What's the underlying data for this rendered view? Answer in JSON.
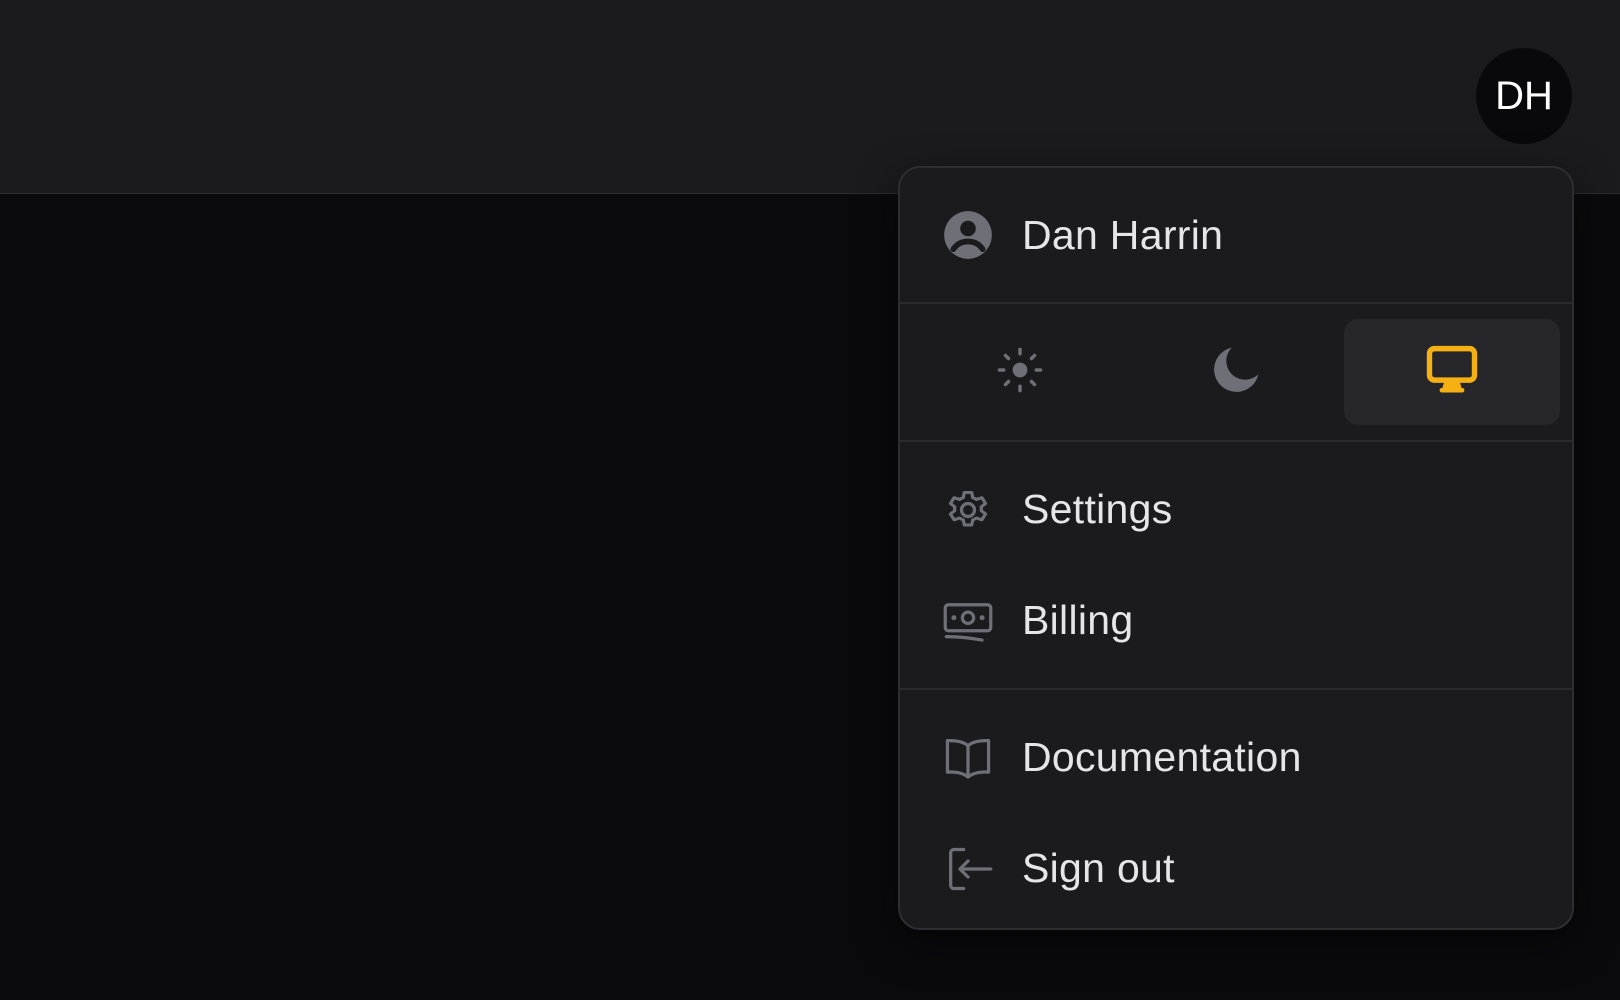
{
  "header": {
    "avatar_initials": "DH"
  },
  "user_menu": {
    "user_name": "Dan Harrin",
    "theme": {
      "options": [
        "light",
        "dark",
        "system"
      ],
      "selected": "system",
      "active_color": "#f5b014",
      "icons": [
        "sun-icon",
        "moon-icon",
        "computer-desktop-icon"
      ]
    },
    "items": [
      {
        "label": "Settings",
        "icon": "gear-icon"
      },
      {
        "label": "Billing",
        "icon": "banknotes-icon"
      }
    ],
    "footer_items": [
      {
        "label": "Documentation",
        "icon": "book-open-icon"
      },
      {
        "label": "Sign out",
        "icon": "sign-out-icon"
      }
    ]
  },
  "colors": {
    "background": "#0a0a0c",
    "topbar": "#1b1b1e",
    "menu_bg": "#1b1b1e",
    "icon_gray": "#6f6f78",
    "text": "#e6e6e8",
    "accent": "#f5b014"
  }
}
